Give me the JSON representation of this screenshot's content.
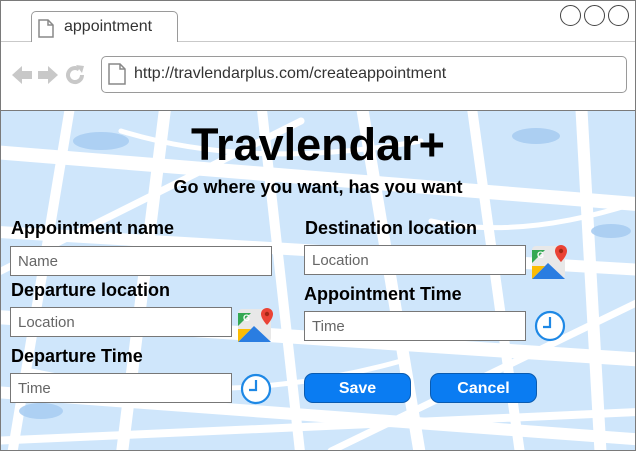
{
  "browser": {
    "tab_title": "appointment",
    "url": "http://travlendarplus.com/createappointment"
  },
  "app": {
    "title": "Travlendar+",
    "tagline": "Go where you want, has you want"
  },
  "form": {
    "appointment_name": {
      "label": "Appointment name",
      "placeholder": "Name"
    },
    "destination_location": {
      "label": "Destination location",
      "placeholder": "Location"
    },
    "departure_location": {
      "label": "Departure location",
      "placeholder": "Location"
    },
    "appointment_time": {
      "label": "Appointment Time",
      "placeholder": "Time"
    },
    "departure_time": {
      "label": "Departure Time",
      "placeholder": "Time"
    }
  },
  "buttons": {
    "save": "Save",
    "cancel": "Cancel"
  },
  "icons": {
    "maps": "google-maps-icon",
    "clock": "clock-icon"
  },
  "colors": {
    "accent": "#0a7cf2",
    "map_bg": "#cfe6fb"
  }
}
